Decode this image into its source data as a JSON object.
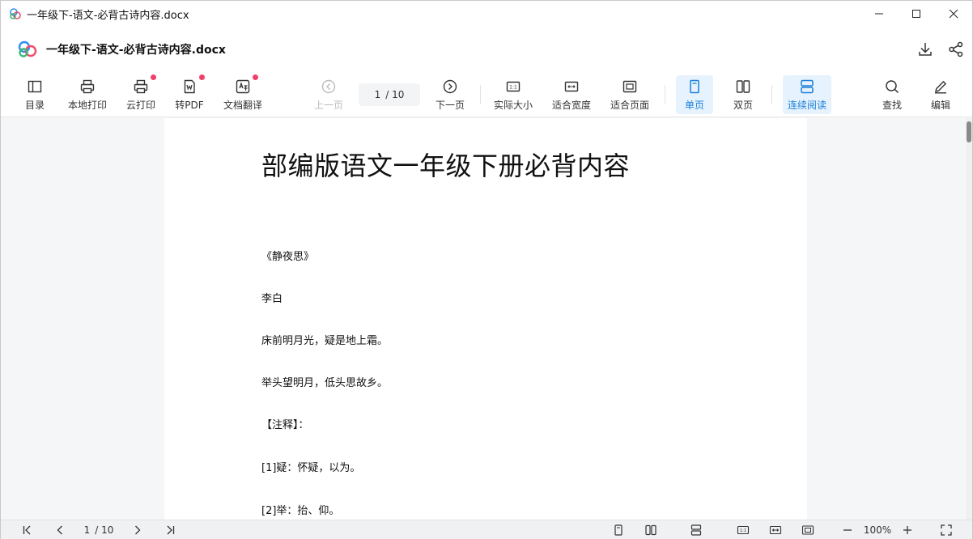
{
  "window": {
    "title": "一年级下-语文-必背古诗内容.docx",
    "controls": {
      "minimize": "minimize-icon",
      "maximize": "maximize-icon",
      "close": "close-icon"
    }
  },
  "header": {
    "doc_title": "一年级下-语文-必背古诗内容.docx",
    "accent_color": "#1a7fd9"
  },
  "toolbar": {
    "toc": "目录",
    "local_print": "本地打印",
    "cloud_print": "云打印",
    "to_pdf": "转PDF",
    "translate": "文档翻译",
    "prev_page": "上一页",
    "page_current": "1",
    "page_total": "/ 10",
    "next_page": "下一页",
    "actual_size": "实际大小",
    "fit_width": "适合宽度",
    "fit_page": "适合页面",
    "single_page": "单页",
    "double_page": "双页",
    "continuous": "连续阅读",
    "find": "查找",
    "edit": "编辑"
  },
  "document": {
    "heading": "部编版语文一年级下册必背内容",
    "paragraphs": [
      "《静夜思》",
      "李白",
      "床前明月光，疑是地上霜。",
      "举头望明月，低头思故乡。",
      "【注释】：",
      "[1]疑：怀疑，以为。",
      "[2]举：抬、仰。"
    ]
  },
  "statusbar": {
    "page_current": "1",
    "page_total": "/ 10",
    "zoom": "100%"
  }
}
